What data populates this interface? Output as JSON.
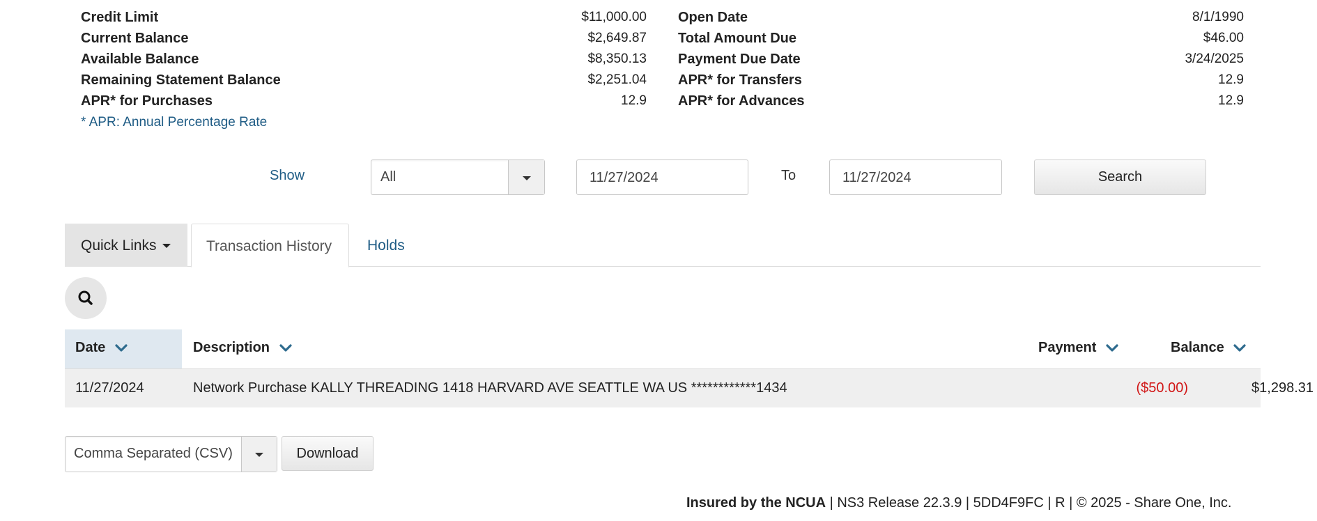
{
  "summary": {
    "left": [
      {
        "label": "Credit Limit",
        "value": "$11,000.00"
      },
      {
        "label": "Current Balance",
        "value": "$2,649.87"
      },
      {
        "label": "Available Balance",
        "value": "$8,350.13"
      },
      {
        "label": "Remaining Statement Balance",
        "value": "$2,251.04"
      },
      {
        "label": "APR* for Purchases",
        "value": "12.9"
      }
    ],
    "right": [
      {
        "label": "Open Date",
        "value": "8/1/1990"
      },
      {
        "label": "Total Amount Due",
        "value": "$46.00"
      },
      {
        "label": "Payment Due Date",
        "value": "3/24/2025"
      },
      {
        "label": "APR* for Transfers",
        "value": "12.9"
      },
      {
        "label": "APR* for Advances",
        "value": "12.9"
      }
    ],
    "apr_note": "* APR: Annual Percentage Rate"
  },
  "filter": {
    "show_label": "Show",
    "show_value": "All",
    "from_date": "11/27/2024",
    "to_label": "To",
    "to_date": "11/27/2024",
    "search_label": "Search"
  },
  "tabs": {
    "quick_links": "Quick Links",
    "transaction_history": "Transaction History",
    "holds": "Holds"
  },
  "table": {
    "headers": {
      "date": "Date",
      "description": "Description",
      "payment": "Payment",
      "balance": "Balance"
    },
    "rows": [
      {
        "date": "11/27/2024",
        "description": "Network Purchase KALLY THREADING 1418 HARVARD AVE SEATTLE WA US ************1434",
        "payment": "($50.00)",
        "balance": "$1,298.31"
      }
    ]
  },
  "export": {
    "format": "Comma Separated (CSV)",
    "download_label": "Download"
  },
  "footer": {
    "insured": "Insured by the NCUA",
    "rest": " | NS3 Release 22.3.9 | 5DD4F9FC | R | © 2025 - Share One, Inc."
  },
  "colors": {
    "link": "#1f5c85",
    "negative": "#d11515",
    "header_bg_sorted": "#dfe8f0"
  }
}
